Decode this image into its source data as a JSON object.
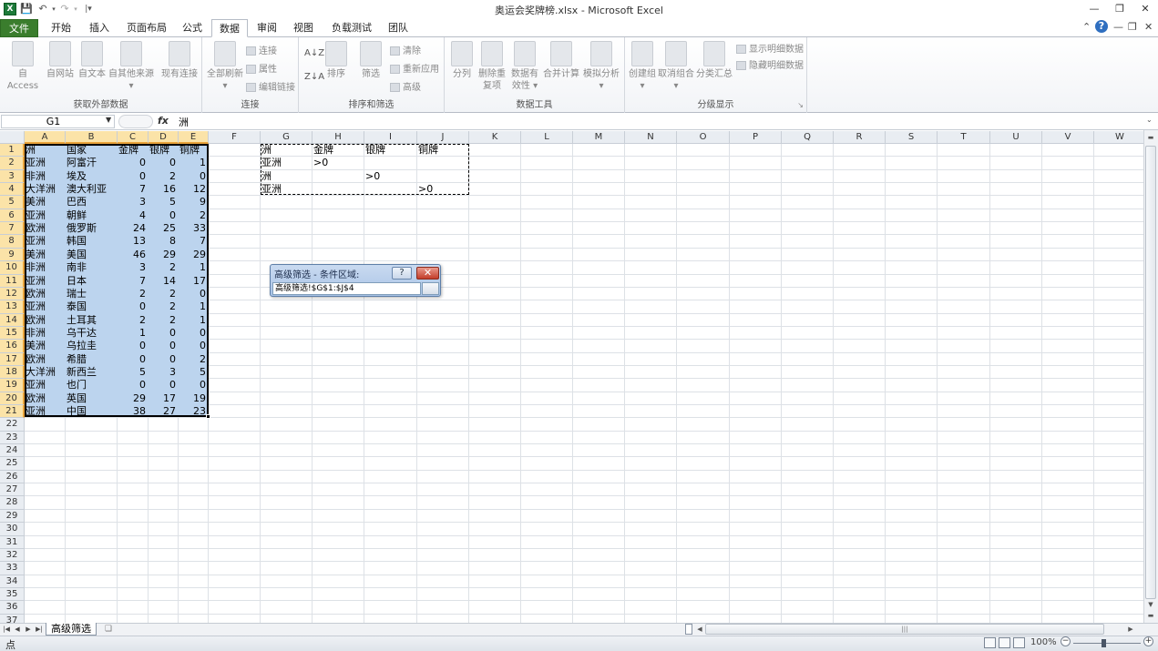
{
  "window": {
    "title": "奥运会奖牌榜.xlsx - Microsoft Excel",
    "logo": "X"
  },
  "qat": {
    "save_icon": "save-icon",
    "undo_icon": "undo-icon",
    "redo_icon": "redo-icon"
  },
  "tabs": [
    {
      "label": "文件"
    },
    {
      "label": "开始"
    },
    {
      "label": "插入"
    },
    {
      "label": "页面布局"
    },
    {
      "label": "公式"
    },
    {
      "label": "数据"
    },
    {
      "label": "审阅"
    },
    {
      "label": "视图"
    },
    {
      "label": "负载测试"
    },
    {
      "label": "团队"
    }
  ],
  "ribbon": {
    "get_external": {
      "label": "获取外部数据",
      "buttons": [
        {
          "label": "自 Access"
        },
        {
          "label": "自网站"
        },
        {
          "label": "自文本"
        },
        {
          "label": "自其他来源"
        },
        {
          "label": "现有连接"
        }
      ]
    },
    "connections": {
      "label": "连接",
      "refresh": "全部刷新",
      "small": [
        {
          "label": "连接"
        },
        {
          "label": "属性"
        },
        {
          "label": "编辑链接"
        }
      ]
    },
    "sort_filter": {
      "label": "排序和筛选",
      "sort": "排序",
      "filter": "筛选",
      "small": [
        {
          "label": "清除"
        },
        {
          "label": "重新应用"
        },
        {
          "label": "高级"
        }
      ]
    },
    "data_tools": {
      "label": "数据工具",
      "buttons": [
        {
          "label": "分列"
        },
        {
          "label": "删除重复项"
        },
        {
          "label": "数据有效性"
        },
        {
          "label": "合并计算"
        },
        {
          "label": "模拟分析"
        }
      ]
    },
    "outline": {
      "label": "分级显示",
      "buttons": [
        {
          "label": "创建组"
        },
        {
          "label": "取消组合"
        },
        {
          "label": "分类汇总"
        }
      ],
      "small": [
        {
          "label": "显示明细数据"
        },
        {
          "label": "隐藏明细数据"
        }
      ]
    }
  },
  "formula_bar": {
    "name_box": "G1",
    "fx": "fx",
    "content": "洲"
  },
  "columns": [
    "A",
    "B",
    "C",
    "D",
    "E",
    "F",
    "G",
    "H",
    "I",
    "J",
    "K",
    "L",
    "M",
    "N",
    "O",
    "P",
    "Q",
    "R",
    "S",
    "T",
    "U",
    "V",
    "W"
  ],
  "rows": [
    "1",
    "2",
    "3",
    "4",
    "5",
    "6",
    "7",
    "8",
    "9",
    "10",
    "11",
    "12",
    "13",
    "14",
    "15",
    "16",
    "17",
    "18",
    "19",
    "20",
    "21",
    "22",
    "23",
    "24",
    "25",
    "26",
    "27",
    "28",
    "29",
    "30",
    "31",
    "32",
    "33",
    "34",
    "35",
    "36",
    "37"
  ],
  "table": {
    "headers": [
      "洲",
      "国家",
      "金牌",
      "银牌",
      "铜牌"
    ],
    "rows": [
      [
        "亚洲",
        "阿富汗",
        "0",
        "0",
        "1"
      ],
      [
        "非洲",
        "埃及",
        "0",
        "2",
        "0"
      ],
      [
        "大洋洲",
        "澳大利亚",
        "7",
        "16",
        "12"
      ],
      [
        "美洲",
        "巴西",
        "3",
        "5",
        "9"
      ],
      [
        "亚洲",
        "朝鲜",
        "4",
        "0",
        "2"
      ],
      [
        "欧洲",
        "俄罗斯",
        "24",
        "25",
        "33"
      ],
      [
        "亚洲",
        "韩国",
        "13",
        "8",
        "7"
      ],
      [
        "美洲",
        "美国",
        "46",
        "29",
        "29"
      ],
      [
        "非洲",
        "南非",
        "3",
        "2",
        "1"
      ],
      [
        "亚洲",
        "日本",
        "7",
        "14",
        "17"
      ],
      [
        "欧洲",
        "瑞士",
        "2",
        "2",
        "0"
      ],
      [
        "亚洲",
        "泰国",
        "0",
        "2",
        "1"
      ],
      [
        "欧洲",
        "土耳其",
        "2",
        "2",
        "1"
      ],
      [
        "非洲",
        "乌干达",
        "1",
        "0",
        "0"
      ],
      [
        "美洲",
        "乌拉圭",
        "0",
        "0",
        "0"
      ],
      [
        "欧洲",
        "希腊",
        "0",
        "0",
        "2"
      ],
      [
        "大洋洲",
        "新西兰",
        "5",
        "3",
        "5"
      ],
      [
        "亚洲",
        "也门",
        "0",
        "0",
        "0"
      ],
      [
        "欧洲",
        "英国",
        "29",
        "17",
        "19"
      ],
      [
        "亚洲",
        "中国",
        "38",
        "27",
        "23"
      ]
    ]
  },
  "criteria": {
    "headers": [
      "洲",
      "金牌",
      "银牌",
      "铜牌"
    ],
    "rows": [
      [
        "亚洲",
        ">0",
        "",
        ""
      ],
      [
        "洲",
        "",
        ">0",
        ""
      ],
      [
        "亚洲",
        "",
        "",
        ">0"
      ]
    ]
  },
  "dialog": {
    "title": "高级筛选 - 条件区域:",
    "help": "?",
    "close": "✕",
    "value": "高级筛选!$G$1:$J$4"
  },
  "sheet": {
    "name": "高级筛选"
  },
  "status": {
    "mode": "点",
    "zoom": "100%",
    "zoom_minus": "−",
    "zoom_plus": "+"
  }
}
